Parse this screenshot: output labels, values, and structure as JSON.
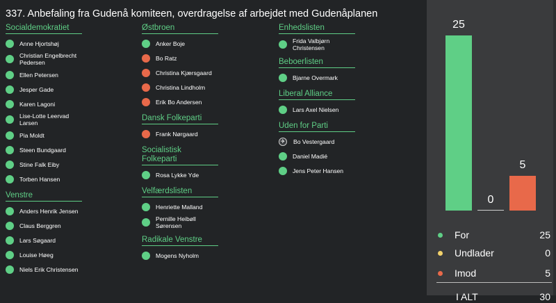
{
  "title": "337. Anbefaling fra Gudenå komiteen, overdragelse af arbejdet med Gudenåplanen",
  "colors": {
    "for": "#5fcf86",
    "against": "#e8694a",
    "abstain": "#f2d16b"
  },
  "columns": [
    [
      {
        "party": "Socialdemokratiet",
        "members": [
          {
            "name": "Anne Hjortshøj",
            "vote": "for"
          },
          {
            "name": "Christian Engelbrecht Pedersen",
            "vote": "for"
          },
          {
            "name": "Ellen Petersen",
            "vote": "for"
          },
          {
            "name": "Jesper Gade",
            "vote": "for"
          },
          {
            "name": "Karen Lagoni",
            "vote": "for"
          },
          {
            "name": "Lise-Lotte Leervad Larsen",
            "vote": "for"
          },
          {
            "name": "Pia Moldt",
            "vote": "for"
          },
          {
            "name": "Steen Bundgaard",
            "vote": "for"
          },
          {
            "name": "Stine Falk Eiby",
            "vote": "for"
          },
          {
            "name": "Torben Hansen",
            "vote": "for"
          }
        ]
      },
      {
        "party": "Venstre",
        "members": [
          {
            "name": "Anders Henrik Jensen",
            "vote": "for"
          },
          {
            "name": "Claus Berggren",
            "vote": "for"
          },
          {
            "name": "Lars Søgaard",
            "vote": "for"
          },
          {
            "name": "Louise Høeg",
            "vote": "for"
          },
          {
            "name": "Niels Erik Christensen",
            "vote": "for"
          }
        ]
      }
    ],
    [
      {
        "party": "Østbroen",
        "members": [
          {
            "name": "Anker Boje",
            "vote": "for"
          },
          {
            "name": "Bo Ratz",
            "vote": "against"
          },
          {
            "name": "Christina Kjærsgaard",
            "vote": "against"
          },
          {
            "name": "Christina Lindholm",
            "vote": "against"
          },
          {
            "name": "Erik Bo Andersen",
            "vote": "against"
          }
        ]
      },
      {
        "party": "Dansk Folkeparti",
        "members": [
          {
            "name": "Frank Nørgaard",
            "vote": "against"
          }
        ]
      },
      {
        "party": "Socialistisk Folkeparti",
        "members": [
          {
            "name": "Rosa Lykke Yde",
            "vote": "for"
          }
        ]
      },
      {
        "party": "Velfærdslisten",
        "members": [
          {
            "name": "Henriette Malland",
            "vote": "for"
          },
          {
            "name": "Pernille Heibøll Sørensen",
            "vote": "for"
          }
        ]
      },
      {
        "party": "Radikale Venstre",
        "members": [
          {
            "name": "Mogens Nyholm",
            "vote": "for"
          }
        ]
      }
    ],
    [
      {
        "party": "Enhedslisten",
        "members": [
          {
            "name": "Frida Valbjørn Christensen",
            "vote": "for"
          }
        ]
      },
      {
        "party": "Beboerlisten",
        "members": [
          {
            "name": "Bjarne Overmark",
            "vote": "for"
          }
        ]
      },
      {
        "party": "Liberal Alliance",
        "members": [
          {
            "name": "Lars Axel Nielsen",
            "vote": "for"
          }
        ]
      },
      {
        "party": "Uden for Parti",
        "members": [
          {
            "name": "Bo Vestergaard",
            "vote": "absent"
          },
          {
            "name": "Daniel Madié",
            "vote": "for"
          },
          {
            "name": "Jens Peter Hansen",
            "vote": "for"
          }
        ]
      }
    ]
  ],
  "chart_data": {
    "type": "bar",
    "categories": [
      "For",
      "Undlader",
      "Imod"
    ],
    "values": [
      25,
      0,
      5
    ],
    "colors": [
      "#5fcf86",
      "#f2d16b",
      "#e8694a"
    ]
  },
  "legend": [
    {
      "label": "For",
      "value": "25",
      "color": "#5fcf86"
    },
    {
      "label": "Undlader",
      "value": "0",
      "color": "#f2d16b"
    },
    {
      "label": "Imod",
      "value": "5",
      "color": "#e8694a"
    }
  ],
  "total": {
    "label": "I ALT",
    "value": "30"
  }
}
